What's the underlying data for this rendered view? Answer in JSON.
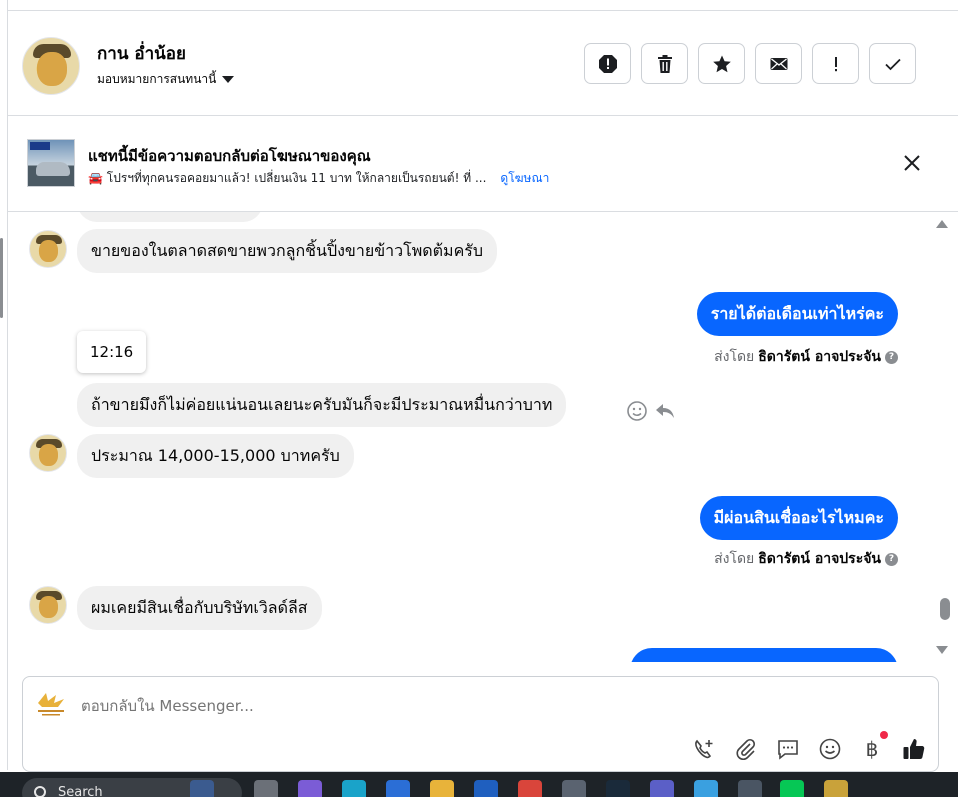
{
  "header": {
    "contact_name": "กาน อ่ำน้อย",
    "assign_label": "มอบหมายการสนทนานี้",
    "actions": [
      {
        "name": "spam-button",
        "icon": "alert-octagon-icon"
      },
      {
        "name": "delete-button",
        "icon": "trash-icon"
      },
      {
        "name": "star-button",
        "icon": "star-icon"
      },
      {
        "name": "mark-unread-button",
        "icon": "envelope-icon"
      },
      {
        "name": "follow-up-button",
        "icon": "exclamation-icon"
      },
      {
        "name": "mark-done-button",
        "icon": "check-icon"
      }
    ]
  },
  "ad_banner": {
    "title": "แชทนี้มีข้อความตอบกลับต่อโฆษณาของคุณ",
    "subtitle": "🚘 โปรฯที่ทุกคนรอคอยมาแล้ว! เปลี่ยนเงิน 11 บาท ให้กลายเป็นรถยนต์! ที่ ...",
    "link": "ดูโฆษณา"
  },
  "messages": [
    {
      "id": "m1",
      "direction": "in",
      "text": "ขายของในตลาดสดขายพวกลูกชิ้นปิ้งขายข้าวโพดต้มครับ"
    },
    {
      "id": "m2",
      "direction": "out",
      "text": "รายได้ต่อเดือนเท่าไหร่คะ",
      "sent_by_prefix": "ส่งโดย",
      "sent_by_name": "ธิดารัตน์ อาจประจัน"
    },
    {
      "id": "m3",
      "direction": "in",
      "text": "ถ้าขายมึงก็ไม่ค่อยแน่นอนเลยนะครับมันก็จะมีประมาณหมื่นกว่าบาท",
      "tooltip_time": "12:16"
    },
    {
      "id": "m4",
      "direction": "in",
      "text": "ประมาณ 14,000-15,000 บาทครับ"
    },
    {
      "id": "m5",
      "direction": "out",
      "text": "มีผ่อนสินเชื่ออะไรไหมคะ",
      "sent_by_prefix": "ส่งโดย",
      "sent_by_name": "ธิดารัตน์ อาจประจัน"
    },
    {
      "id": "m6",
      "direction": "in",
      "text": "ผมเคยมีสินเชื่อกับบริษัทเวิลด์ลีส"
    }
  ],
  "composer": {
    "placeholder": "ตอบกลับใน Messenger...",
    "currency_symbol": "฿",
    "tools": [
      "call-add-icon",
      "attachment-icon",
      "saved-reply-icon",
      "emoji-icon",
      "payment-icon",
      "like-icon"
    ]
  },
  "taskbar": {
    "search_label": "Search"
  },
  "colors": {
    "accent": "#0866ff",
    "incoming_bubble": "#f0f0f0",
    "notification_dot": "#f02849"
  }
}
